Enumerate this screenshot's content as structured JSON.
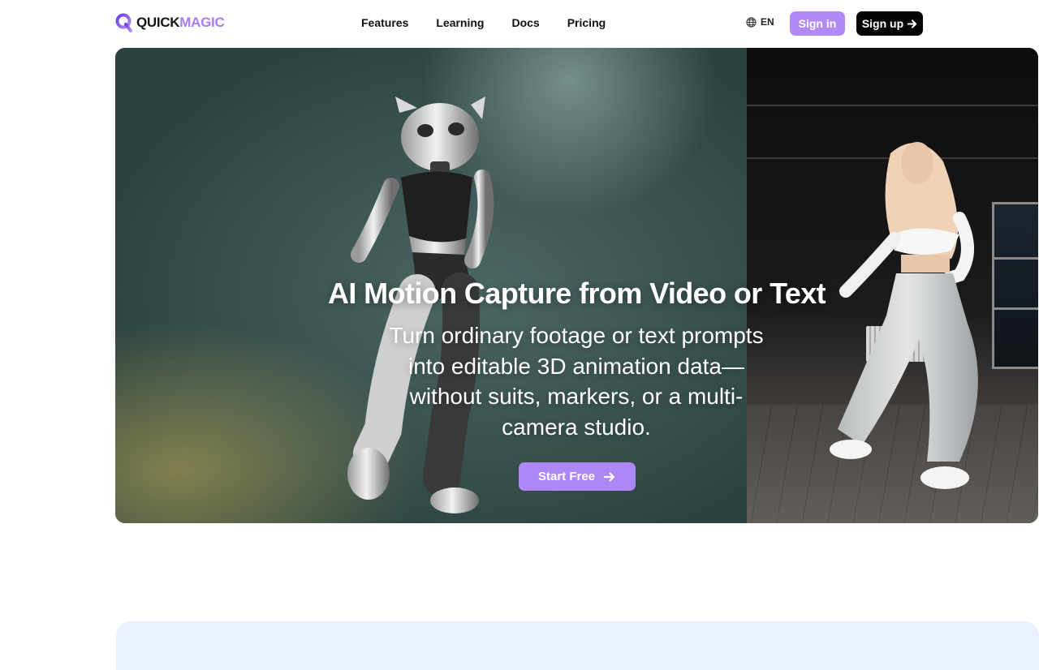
{
  "header": {
    "logo": {
      "part1": "QUICK",
      "part2": "MAGIC"
    },
    "nav": [
      {
        "label": "Features"
      },
      {
        "label": "Learning"
      },
      {
        "label": "Docs"
      },
      {
        "label": "Pricing"
      }
    ],
    "language": {
      "label": "EN",
      "icon": "globe-icon"
    },
    "signin_label": "Sign in",
    "signup_label": "Sign up"
  },
  "hero": {
    "title": "AI Motion Capture from Video or Text",
    "subtitle": "Turn ordinary footage or text prompts into editable 3D animation data—without suits, markers, or a multi-camera studio.",
    "cta_label": "Start Free"
  },
  "colors": {
    "brand_purple": "#b18af7",
    "cta_purple": "#ae87f6",
    "signup_black": "#050505",
    "next_section_bg": "#eaf1fd"
  }
}
